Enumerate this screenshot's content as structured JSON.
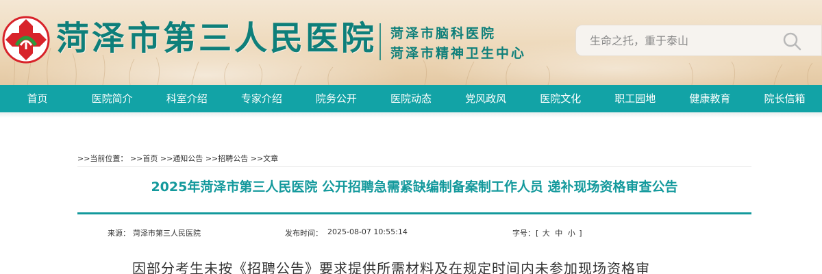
{
  "header": {
    "title": "菏泽市第三人民医院",
    "subtitle_1": "菏泽市脑科医院",
    "subtitle_2": "菏泽市精神卫生中心",
    "search": {
      "placeholder": "生命之托，重于泰山"
    },
    "logo_icon": "red-cross-logo-icon",
    "search_icon": "search-icon",
    "colors": {
      "brand_teal": "#0e7f7a",
      "nav_teal": "#12a3a6",
      "logo_red": "#d8232a"
    }
  },
  "nav": {
    "items": [
      "首页",
      "医院简介",
      "科室介绍",
      "专家介绍",
      "院务公开",
      "医院动态",
      "党风政风",
      "医院文化",
      "职工园地",
      "健康教育",
      "院长信箱"
    ]
  },
  "breadcrumb": {
    "label": ">>当前位置：",
    "items": [
      ">>首页",
      ">>通知公告",
      ">>招聘公告",
      ">>文章"
    ]
  },
  "article": {
    "title": "2025年菏泽市第三人民医院 公开招聘急需紧缺编制备案制工作人员 递补现场资格审查公告",
    "source_label": "来源：",
    "source": "菏泽市第三人民医院",
    "time_label": "发布时间：",
    "time": "2025-08-07 10:55:14",
    "font_size_label": "字号：",
    "font_size_open": "[",
    "font_sizes": [
      "大",
      "中",
      "小"
    ],
    "font_size_close": "]",
    "body_first_line": "因部分考生未按《招聘公告》要求提供所需材料及在规定时间内未参加现场资格审"
  }
}
